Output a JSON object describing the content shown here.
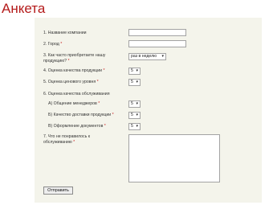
{
  "title": "Анкета",
  "form": {
    "company": {
      "label": "1. Название компании",
      "value": ""
    },
    "city": {
      "label": "2. Город",
      "required_mark": "*",
      "value": ""
    },
    "frequency": {
      "label_line1": "3. Как часто приобретаете нашу",
      "label_line2": "продукцию?",
      "required_mark": "*",
      "value": "раз в неделю"
    },
    "quality": {
      "label": "4. Оценка качества продукции",
      "required_mark": "*",
      "value": "5"
    },
    "price": {
      "label": "5. Оценка ценового уровня",
      "required_mark": "*",
      "value": "5"
    },
    "service": {
      "label": "6. Оценка качества обслуживания",
      "managers": {
        "label": "А) Общение менеджеров",
        "required_mark": "*",
        "value": "5"
      },
      "delivery": {
        "label": "Б) Качество доставки продукции",
        "required_mark": "*",
        "value": "5"
      },
      "docs": {
        "label": "В) Оформление документов",
        "required_mark": "*",
        "value": "5"
      }
    },
    "complaints": {
      "label_line1": "7. Что не понравилось к",
      "label_line2": "обслуживанию",
      "required_mark": "*",
      "value": ""
    },
    "submit_label": "Отправить"
  },
  "colors": {
    "title": "#b41a1a",
    "panel": "#f4f4eb",
    "required": "#c81e1e"
  },
  "icons": {
    "select_arrow": "chevron-down-icon"
  }
}
